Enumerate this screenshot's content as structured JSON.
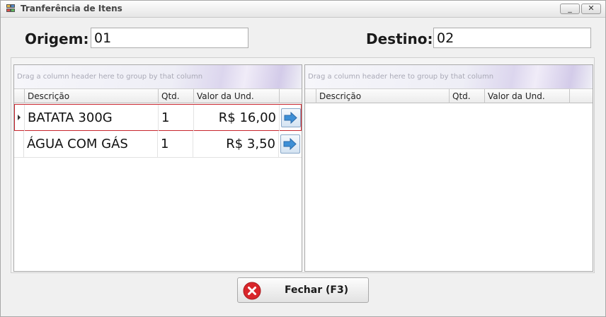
{
  "window": {
    "title": "Tranferência de Itens",
    "minimize_glyph": "_",
    "close_glyph": "✕"
  },
  "origin": {
    "label": "Origem:",
    "value": "01"
  },
  "destination": {
    "label": "Destino:",
    "value": "02"
  },
  "grid_hint": "Drag a column header here to group by that column",
  "columns": [
    "Descrição",
    "Qtd.",
    "Valor da Und."
  ],
  "source_items": [
    {
      "descricao": "BATATA 300G",
      "qtd": "1",
      "valor": "R$ 16,00"
    },
    {
      "descricao": "ÁGUA COM GÁS",
      "qtd": "1",
      "valor": "R$ 3,50"
    }
  ],
  "destination_items": [],
  "close_button": {
    "label": "Fechar (F3)"
  },
  "icons": {
    "move": "arrow-right-icon",
    "close": "close-circle-icon"
  },
  "colors": {
    "selected_border": "#c8262e",
    "close_icon": "#d9262b",
    "arrow": "#3d8fd6"
  }
}
